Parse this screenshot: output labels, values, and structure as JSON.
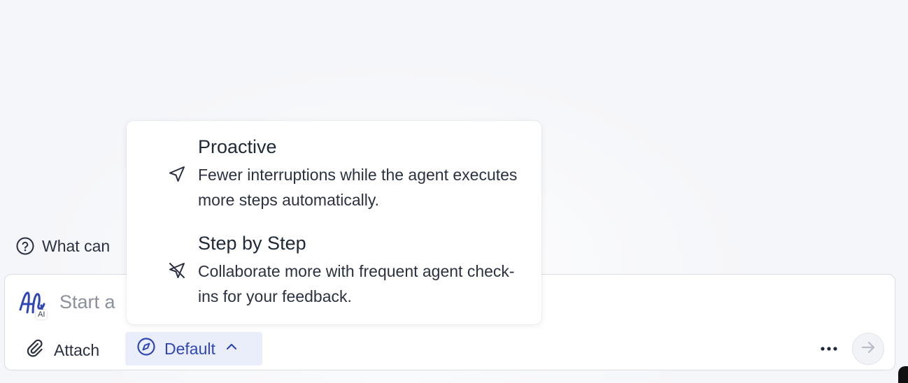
{
  "hint": {
    "text": "What can",
    "icon": "question-circle-icon"
  },
  "composer": {
    "logo_badge": "AI",
    "prompt": "Start a",
    "attach_label": "Attach",
    "mode_label": "Default",
    "icons": {
      "logo": "agent-logo-icon",
      "attach": "paperclip-icon",
      "mode": "compass-icon",
      "mode_chevron": "chevron-up-icon",
      "more": "more-horizontal-icon",
      "send": "arrow-right-icon"
    }
  },
  "mode_menu": {
    "items": [
      {
        "title": "Proactive",
        "description": "Fewer interruptions while the agent executes more steps automatically.",
        "icon": "navigation-arrow-icon"
      },
      {
        "title": "Step by Step",
        "description": "Collaborate more with frequent agent check-ins for your feedback.",
        "icon": "navigation-arrow-off-icon"
      }
    ]
  },
  "colors": {
    "accent": "#2f46b5",
    "mode_button_bg": "#eaeefb",
    "text": "#1f2937",
    "placeholder": "#8a909c"
  }
}
